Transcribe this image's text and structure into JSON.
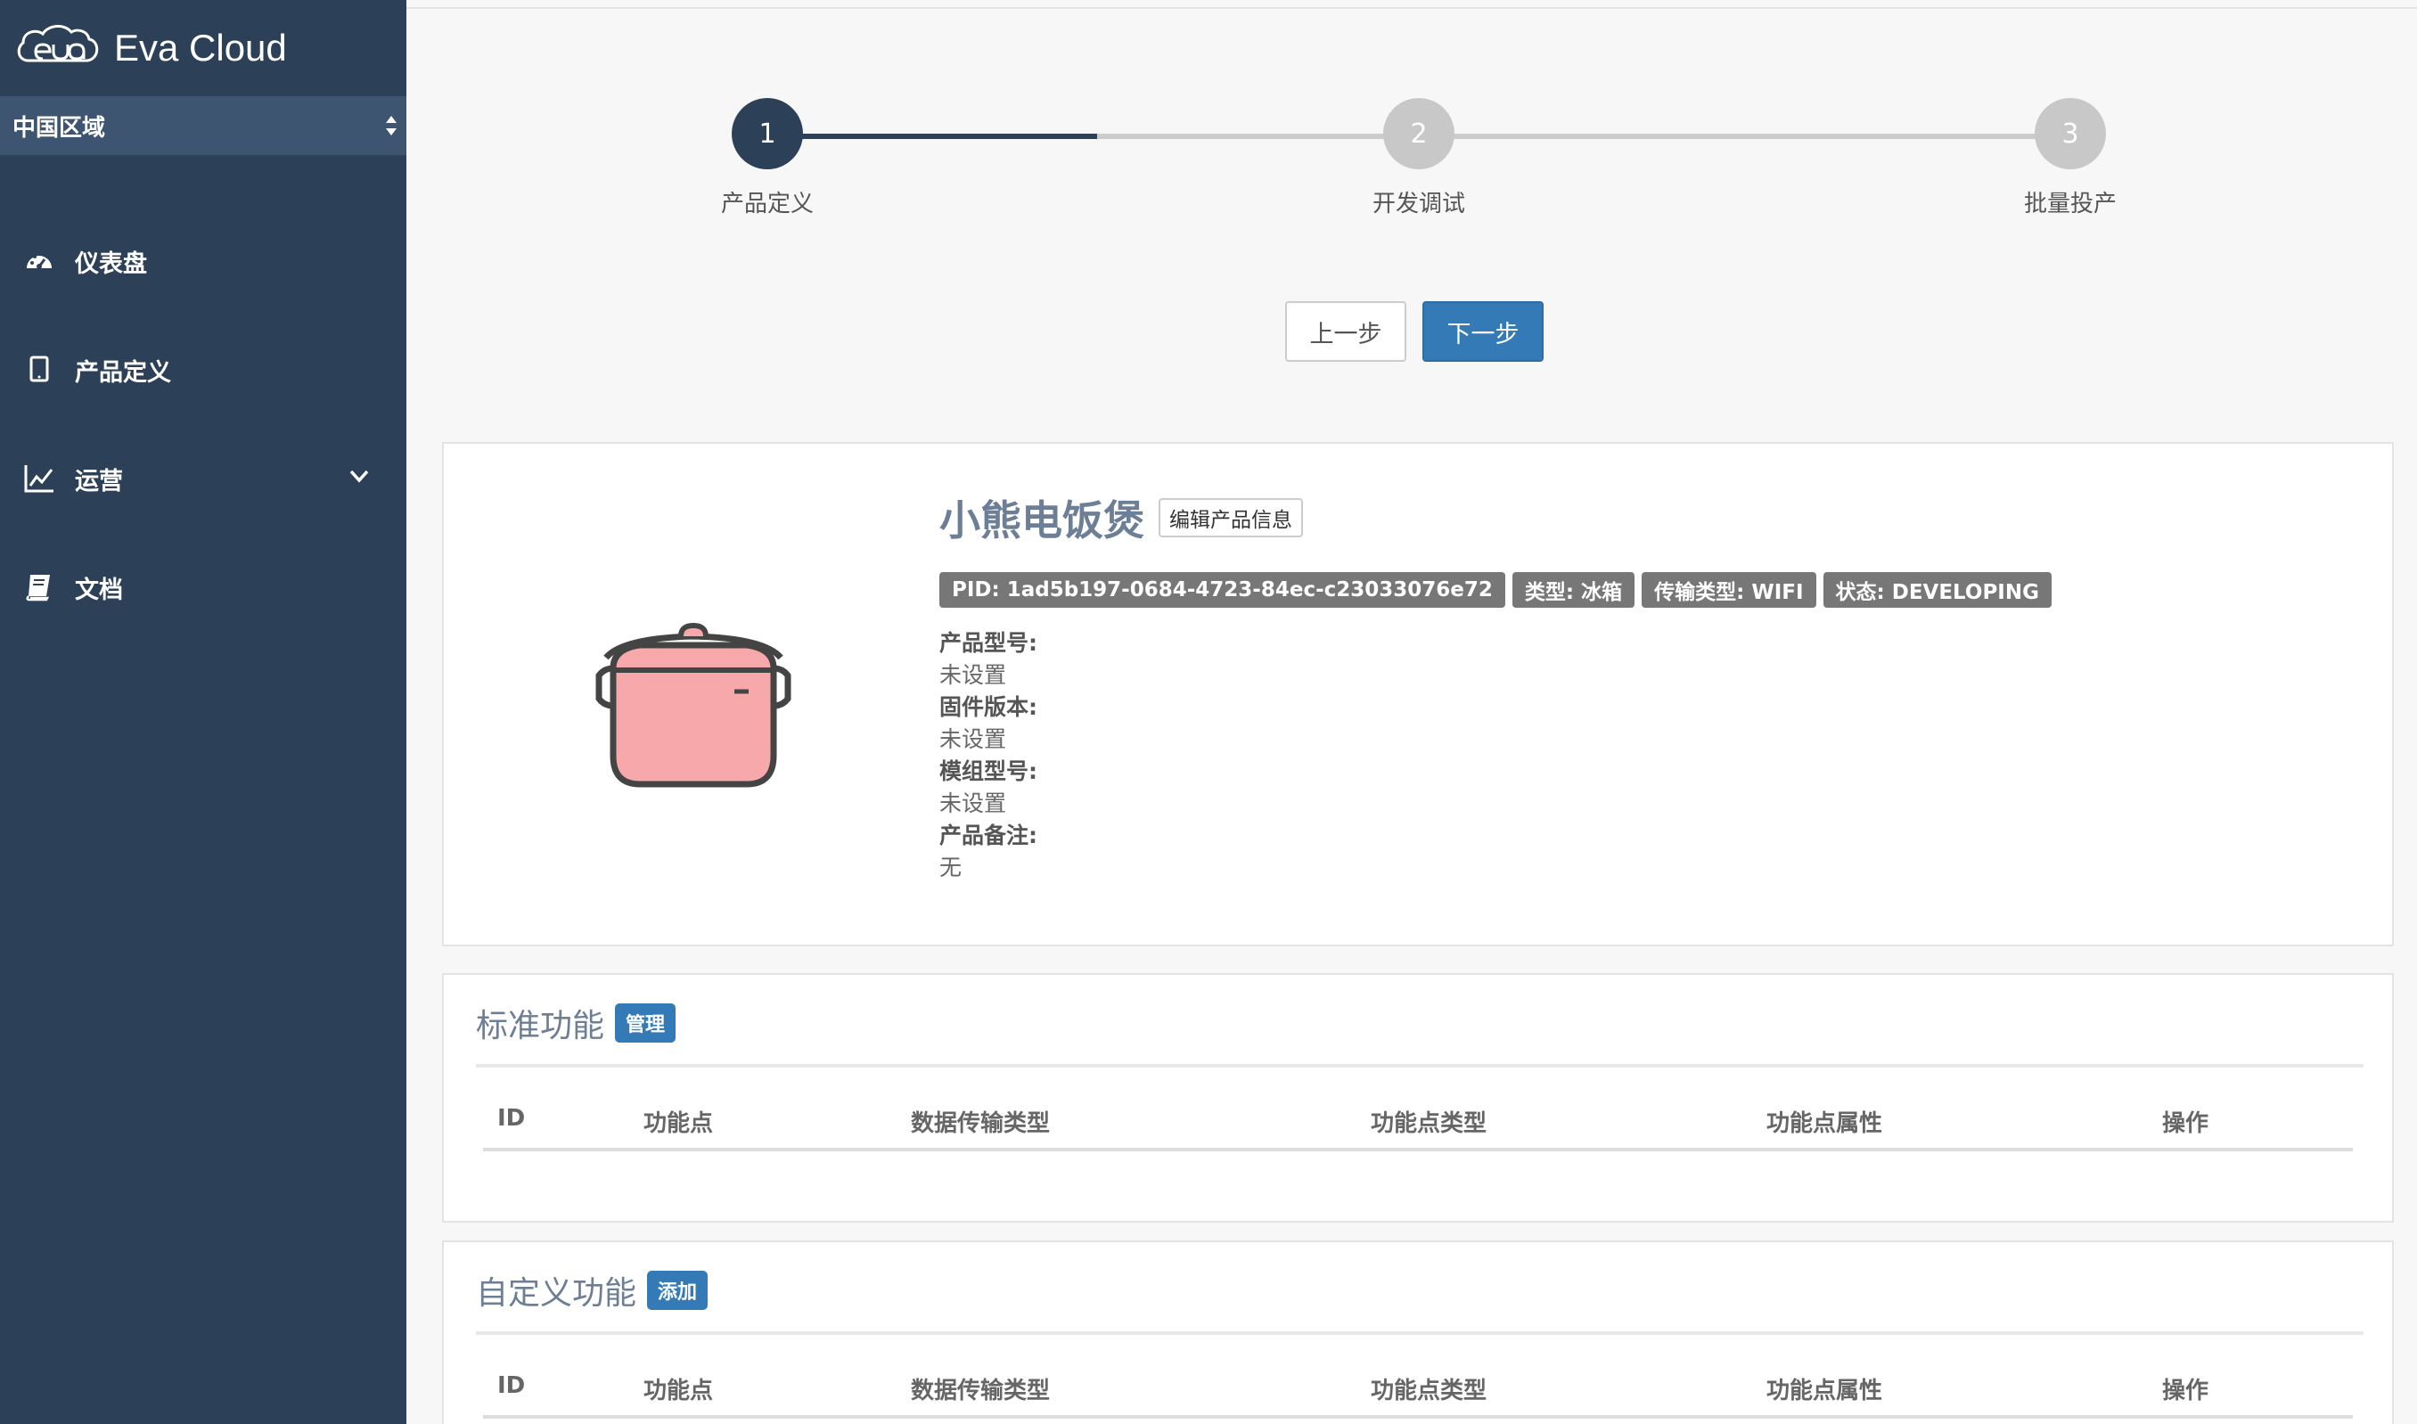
{
  "app": {
    "brand_name": "Eva Cloud",
    "region_label": "中国区域"
  },
  "sidebar": {
    "items": [
      {
        "label": "仪表盘",
        "icon": "dashboard-icon"
      },
      {
        "label": "产品定义",
        "icon": "tablet-icon"
      },
      {
        "label": "运营",
        "icon": "line-chart-icon",
        "expandable": true
      },
      {
        "label": "文档",
        "icon": "book-icon"
      }
    ]
  },
  "steps": {
    "items": [
      {
        "number": "1",
        "label": "产品定义",
        "active": true
      },
      {
        "number": "2",
        "label": "开发调试",
        "active": false
      },
      {
        "number": "3",
        "label": "批量投产",
        "active": false
      }
    ],
    "prev_label": "上一步",
    "next_label": "下一步"
  },
  "product": {
    "name": "小熊电饭煲",
    "edit_label": "编辑产品信息",
    "tags": [
      "PID: 1ad5b197-0684-4723-84ec-c23033076e72",
      "类型: 冰箱",
      "传输类型: WIFI",
      "状态: DEVELOPING"
    ],
    "properties": [
      {
        "key": "产品型号:",
        "value": "未设置"
      },
      {
        "key": "固件版本:",
        "value": "未设置"
      },
      {
        "key": "模组型号:",
        "value": "未设置"
      },
      {
        "key": "产品备注:",
        "value": "无"
      }
    ]
  },
  "standard_functions": {
    "title": "标准功能",
    "action_label": "管理",
    "columns": [
      "ID",
      "功能点",
      "数据传输类型",
      "功能点类型",
      "功能点属性",
      "操作"
    ]
  },
  "custom_functions": {
    "title": "自定义功能",
    "action_label": "添加",
    "columns": [
      "ID",
      "功能点",
      "数据传输类型",
      "功能点类型",
      "功能点属性",
      "操作"
    ]
  },
  "colors": {
    "sidebar_bg": "#2c4058",
    "region_bg": "#3d5571",
    "primary": "#337ab7",
    "step_active": "#2c4058",
    "step_inactive": "#c8c8c8",
    "tag_bg": "#777777",
    "pot_fill": "#f7a8ab"
  }
}
